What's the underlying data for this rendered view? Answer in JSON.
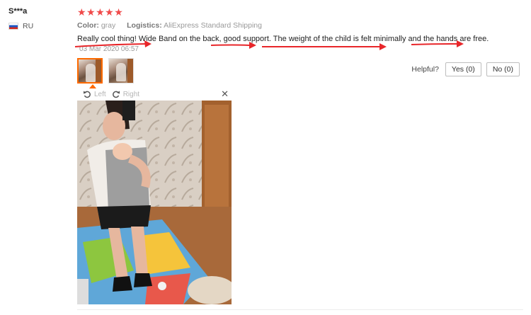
{
  "reviewer": {
    "name": "S***a",
    "country": "RU"
  },
  "review": {
    "stars_text": "★★★★★",
    "rating": 5,
    "color_label": "Color:",
    "color_value": "gray",
    "logistics_label": "Logistics:",
    "logistics_value": "AliExpress Standard Shipping",
    "text": "Really cool thing! Wide Band on the back, good support. The weight of the child is felt minimally and the hands are free.",
    "date": "03 Mar 2020 06:57"
  },
  "helpful": {
    "label": "Helpful?",
    "yes": "Yes (0)",
    "no": "No (0)"
  },
  "viewer": {
    "rotate_left": "Left",
    "rotate_right": "Right",
    "close": "✕"
  },
  "colors": {
    "accent": "#ff6a00",
    "stars": "#f04a4a",
    "arrows": "#e8262a"
  },
  "icons": [
    "flag-ru-icon",
    "rotate-left-icon",
    "rotate-right-icon",
    "close-icon"
  ]
}
